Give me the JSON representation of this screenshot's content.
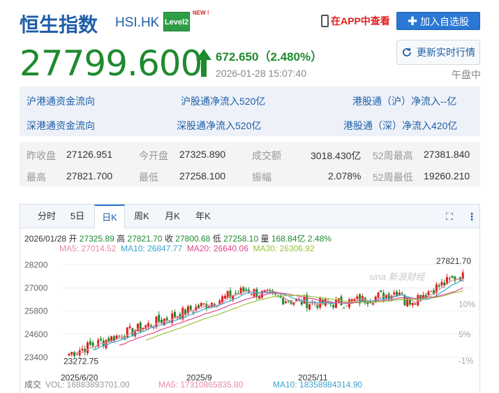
{
  "header": {
    "title": "恒生指数",
    "code": "HSI.HK",
    "level2": "Level2",
    "new_tag": "NEW !",
    "app_link": "在APP中查看",
    "add_button": "加入自选股"
  },
  "quote": {
    "price": "27799.600",
    "change": "672.650（2.480%）",
    "timestamp": "2026-01-28 15:07:40",
    "refresh_button": "更新实时行情",
    "session": "午盘中"
  },
  "flow": {
    "row1": [
      "沪港通资金流向",
      "沪股通净流入520亿",
      "港股通（沪）净流入--亿"
    ],
    "row2": [
      "深港通资金流向",
      "深股通净流入520亿",
      "港股通（深）净流入420亿"
    ]
  },
  "stats": {
    "row1": [
      {
        "label": "昨收盘",
        "value": "27126.951"
      },
      {
        "label": "今开盘",
        "value": "27325.890"
      },
      {
        "label": "成交额",
        "value": "3018.430亿"
      },
      {
        "label": "52周最高",
        "value": "27381.840"
      }
    ],
    "row2": [
      {
        "label": "最高",
        "value": "27821.700"
      },
      {
        "label": "最低",
        "value": "27258.100"
      },
      {
        "label": "振幅",
        "value": "2.078%"
      },
      {
        "label": "52周最低",
        "value": "19260.210"
      }
    ]
  },
  "chart": {
    "tabs": [
      "分时",
      "5日",
      "日K",
      "周K",
      "月K",
      "年K"
    ],
    "active_tab": "日K",
    "ohlc": {
      "date": "2026/01/28",
      "open_label": "开",
      "open": "27325.89",
      "high_label": "高",
      "high": "27821.70",
      "close_label": "收",
      "close": "27800.68",
      "low_label": "低",
      "low": "27258.10",
      "vol_label": "量",
      "vol": "168.84亿",
      "pct": "2.48%"
    },
    "ma": [
      {
        "label": "MA5: 27014.52",
        "color": "#e88aa6"
      },
      {
        "label": "MA10: 26847.77",
        "color": "#3ba3d0"
      },
      {
        "label": "MA20: 26640.06",
        "color": "#d94a8c"
      },
      {
        "label": "MA30: 26306.92",
        "color": "#9bc33a"
      }
    ],
    "y_ticks": [
      "28200",
      "27000",
      "25800",
      "24600",
      "23400"
    ],
    "pct_ticks": [
      "10%",
      "5%",
      "-1%"
    ],
    "x_ticks": [
      "2025/6/20",
      "2025/9",
      "2025/11"
    ],
    "max_label": "27821.70",
    "min_label": "23272.75",
    "watermark": "sina 新浪财经",
    "volume": {
      "label": "成交",
      "vol": "VOL: 16883893701.00",
      "ma5": "MA5: 17310865835.80",
      "ma10": "MA10: 18358984314.90"
    },
    "colors": {
      "up": "#e02020",
      "down": "#1e8a2e"
    }
  }
}
